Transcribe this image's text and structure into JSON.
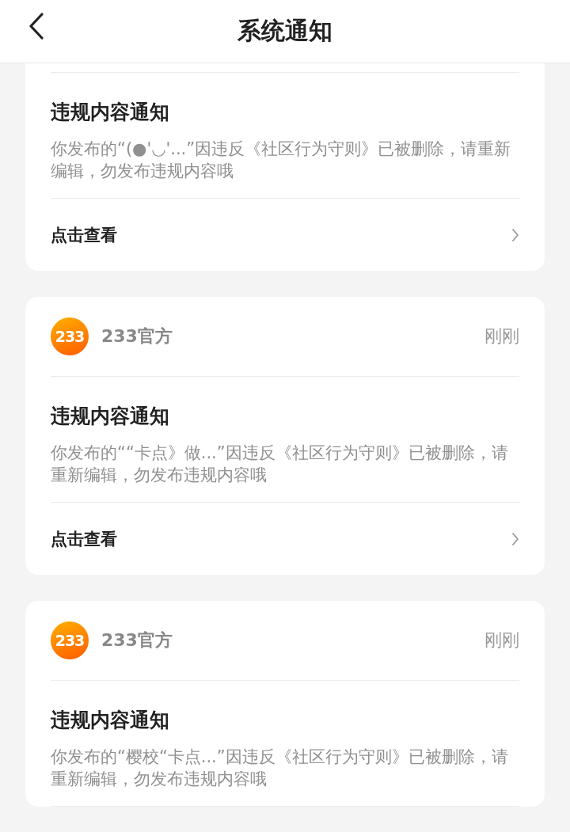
{
  "header": {
    "title": "系统通知"
  },
  "notices": [
    {
      "title": "违规内容通知",
      "body": "你发布的“(●'◡'...”因违反《社区行为守则》已被删除，请重新编辑，勿发布违规内容哦",
      "action": "点击查看"
    },
    {
      "sender": {
        "logo": "233",
        "name": "233官方"
      },
      "time": "刚刚",
      "title": "违规内容通知",
      "body": "你发布的““卡点》做...”因违反《社区行为守则》已被删除，请重新编辑，勿发布违规内容哦",
      "action": "点击查看"
    },
    {
      "sender": {
        "logo": "233",
        "name": "233官方"
      },
      "time": "刚刚",
      "title": "违规内容通知",
      "body": "你发布的“樱校“卡点...”因违反《社区行为守则》已被删除，请重新编辑，勿发布违规内容哦"
    }
  ]
}
